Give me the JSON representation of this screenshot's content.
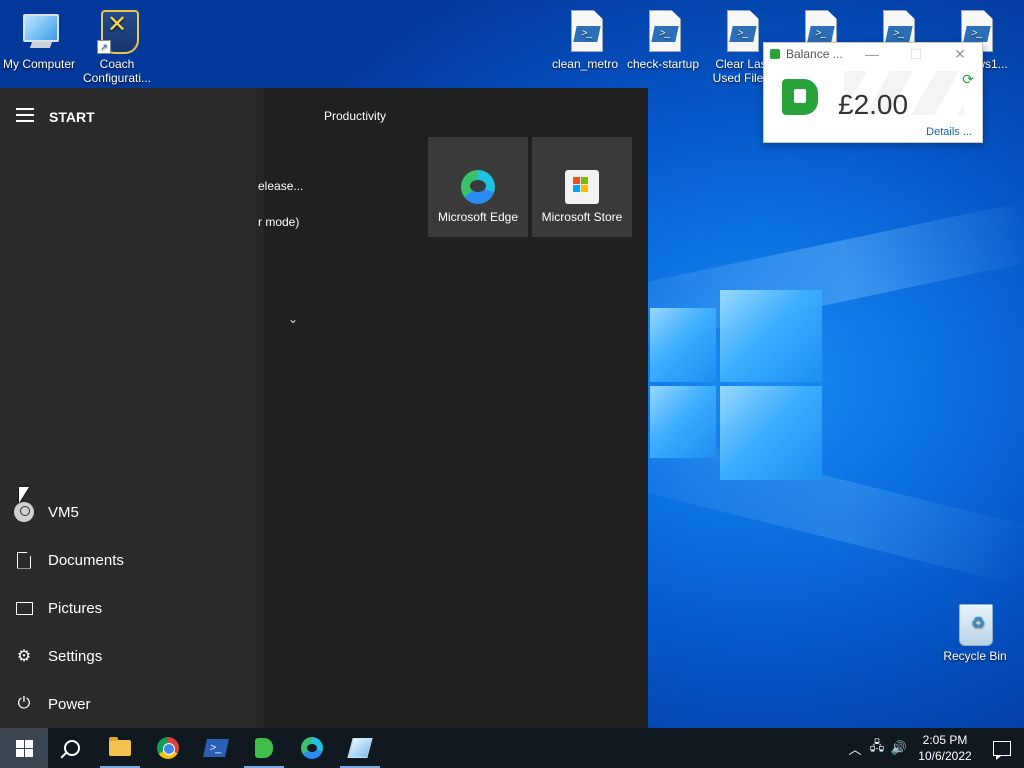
{
  "desktop": {
    "icons": [
      {
        "label": "My Computer",
        "icon": "computer-icon"
      },
      {
        "label": "Coach Configurati...",
        "icon": "coach-config-icon"
      },
      {
        "label": "clean_metro",
        "icon": "powershell-script-icon"
      },
      {
        "label": "check-startup",
        "icon": "powershell-script-icon"
      },
      {
        "label": "Clear Las… Used Files",
        "icon": "powershell-script-icon"
      },
      {
        "label": "",
        "icon": "powershell-script-icon"
      },
      {
        "label": "",
        "icon": "powershell-script-icon"
      },
      {
        "label": "ws1...",
        "icon": "powershell-script-icon"
      },
      {
        "label": "Recycle Bin",
        "icon": "recycle-bin-icon"
      }
    ],
    "coach_line1": "Coach",
    "coach_line2": "Configurati...",
    "clear_line1": "Clear Las",
    "clear_line2": "Used Files"
  },
  "balance_widget": {
    "title": "Balance ...",
    "amount": "£2.00",
    "details_link": "Details ...",
    "accent": "#2aa33b"
  },
  "start_menu": {
    "header": "START",
    "app_fragments": [
      "elease...",
      "r mode)"
    ],
    "group_title": "Productivity",
    "tiles": [
      {
        "label": "Microsoft Edge",
        "icon": "edge-icon"
      },
      {
        "label": "Microsoft Store",
        "icon": "store-icon"
      }
    ],
    "left_items": [
      {
        "label": "VM5",
        "icon": "user-icon"
      },
      {
        "label": "Documents",
        "icon": "document-icon"
      },
      {
        "label": "Pictures",
        "icon": "pictures-icon"
      },
      {
        "label": "Settings",
        "icon": "gear-icon"
      },
      {
        "label": "Power",
        "icon": "power-icon"
      }
    ]
  },
  "taskbar": {
    "apps": [
      "start",
      "search",
      "file-explorer",
      "chrome",
      "powershell",
      "pushpay",
      "edge",
      "app"
    ],
    "tray": {
      "time": "2:05 PM",
      "date": "10/6/2022"
    }
  },
  "colors": {
    "taskbar_bg": "#101820",
    "start_bg": "#202020",
    "tile_bg": "#3a3a3a"
  }
}
